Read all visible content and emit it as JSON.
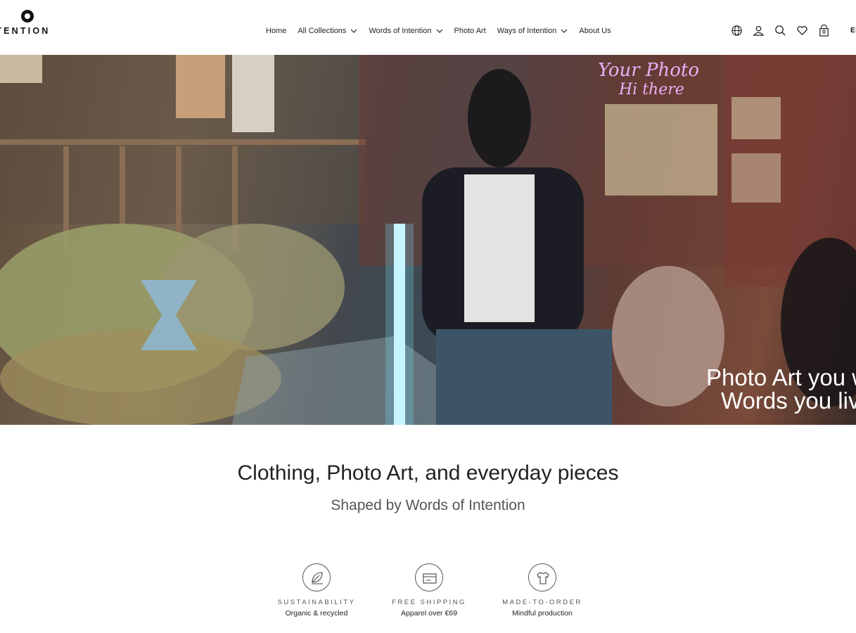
{
  "header": {
    "logo_text": "NTENTION",
    "nav": [
      {
        "label": "Home",
        "has_dropdown": false
      },
      {
        "label": "All Collections",
        "has_dropdown": true
      },
      {
        "label": "Words of Intention",
        "has_dropdown": true
      },
      {
        "label": "Photo Art",
        "has_dropdown": false
      },
      {
        "label": "Ways of Intention",
        "has_dropdown": true
      },
      {
        "label": "About Us",
        "has_dropdown": false
      }
    ],
    "icons": [
      "globe-icon",
      "account-icon",
      "search-icon",
      "wishlist-heart-icon",
      "cart-bag-icon"
    ],
    "cart_count": "0",
    "language": "EN"
  },
  "hero": {
    "line1": "Photo Art you we",
    "line2": "Words you live b"
  },
  "intro": {
    "title": "Clothing, Photo Art, and everyday pieces",
    "subtitle": "Shaped by Words of Intention"
  },
  "features": [
    {
      "icon": "leaf-icon",
      "title": "SUSTAINABILITY",
      "subtitle": "Organic & recycled"
    },
    {
      "icon": "shipping-box-icon",
      "title": "FREE SHIPPING",
      "subtitle": "Apparel over €69"
    },
    {
      "icon": "tshirt-icon",
      "title": "MADE-TO-ORDER",
      "subtitle": "Mindful production"
    }
  ]
}
